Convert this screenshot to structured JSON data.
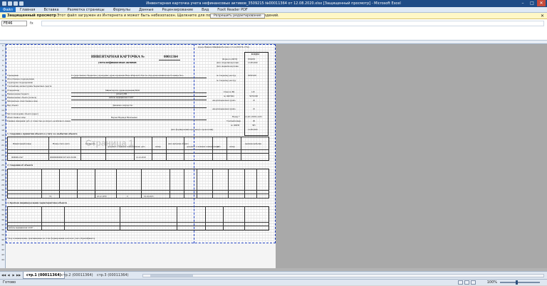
{
  "window": {
    "title": "Инвентарная карточка учета нефинансовых активов_3509215 №00011364 от 12.08.2020.xlsx [Защищенный просмотр] - Microsoft Excel"
  },
  "menu": {
    "file": "Файл",
    "items": [
      "Главная",
      "Вставка",
      "Разметка страницы",
      "Формулы",
      "Данные",
      "Рецензирование",
      "Вид",
      "Foxit Reader PDF"
    ]
  },
  "protected_view": {
    "label": "Защищенный просмотр",
    "message": "Этот файл загружен из Интернета и может быть небезопасен. Щелкните для получения дополнительных сведений.",
    "enable_button": "Разрешить редактирование"
  },
  "formula_bar": {
    "name_box": "FE46",
    "fx": "fx",
    "value": ""
  },
  "form": {
    "header_note": "(в ред. Приказа Минфина России от 15.12.2010 № 173н)",
    "title": "ИНВЕНТАРНАЯ КАРТОЧКА №",
    "number": "00011364",
    "subtitle": "учета нефинансовых активов",
    "codes_header": "КОДЫ",
    "codes": [
      {
        "label": "Форма по ОКУД",
        "value": "0504031"
      },
      {
        "label": "Дата открытия карточки",
        "value": "12.08.2020"
      },
      {
        "label": "Дата закрытия карточки",
        "value": ""
      },
      {
        "label": "по Сводному реестру",
        "value": "30505205"
      },
      {
        "label": "по Сводному реестру",
        "value": ""
      },
      {
        "label": "Глава по БК",
        "value": "120"
      },
      {
        "label": "по ОКТМО",
        "value": "50701000"
      },
      {
        "label": "Амортизационная группа",
        "value": "10"
      },
      {
        "label": "Амортизационная группа",
        "value": "10"
      },
      {
        "label": "Номер *",
        "value": "14-ОС-00301-2232"
      },
      {
        "label": "Учетный номер",
        "value": "00"
      },
      {
        "label": "по ОКЕИ",
        "value": "383"
      }
    ],
    "fields": [
      {
        "label": "Учреждение",
        "value": "Государственное бюджетное учреждение здравоохранения Новосибирской области «Городская клиническая больница №1»"
      },
      {
        "label": "Обособленное подразделение",
        "value": ""
      },
      {
        "label": "Структурное подразделение",
        "value": ""
      },
      {
        "label": "Учетный вид актива/группы бюджетных средств",
        "value": ""
      },
      {
        "label": "(Учредитель)",
        "value": "Министерство здравоохранения ВОО"
      },
      {
        "label": "Наименование бюджета",
        "value": "(област) РФ"
      },
      {
        "label": "Наименование объекта (полное)",
        "value": "мебель медицинская 12227"
      },
      {
        "label": "Материально ответственное лицо",
        "value": ""
      },
      {
        "label": "Вид объекта",
        "value": "Движимое имущество"
      },
      {
        "label": "Местонахождение объекта (адрес)",
        "value": ""
      },
      {
        "label": "Ответственное лицо",
        "value": "Верова Надежда Васильевна"
      },
      {
        "label": "Единица измерения: руб. (с точностью до второго десятичного знака)",
        "value": ""
      }
    ],
    "card_date_label": "Дата формирования карточки (по хронологии)",
    "card_date": "12.08.2020",
    "section1_title": "1. Сведения о принятии объекта к учету и о выбытии объекта",
    "section1_cols": [
      "Инвентарный номер",
      "Номер счета учета",
      "Стоимость",
      "документ основание: наименование",
      "дата",
      "номер",
      "Дата выбытия объекта",
      "документ основание: наименование",
      "дата",
      "номер",
      "причина выбытия"
    ],
    "section1_row": [
      "00000012347",
      "000000000000 00+410131000",
      "",
      "",
      "12.12.2019",
      "",
      "",
      "",
      "",
      "",
      ""
    ],
    "section2_title": "2. Сведения об объекте",
    "section2_row": [
      "",
      "74",
      "",
      "",
      "22.12.1970",
      "0",
      "01.10.2015",
      "",
      "",
      "",
      "",
      "",
      "",
      ""
    ],
    "section3_title": "3. Краткая индивидуальная характеристика объекта",
    "section3_item": "мебель медицинская 12227",
    "footnote": "* Код и наименование, присваиваемые на этапе формирования в каталоге учета, Идентификатор"
  },
  "watermark": "Страница 1",
  "sheet_tabs": [
    "стр.1 (00011364)",
    "стр.2 (00011364)",
    "стр.3 (00011364)"
  ],
  "status": {
    "ready": "Готово",
    "zoom": "100%"
  }
}
